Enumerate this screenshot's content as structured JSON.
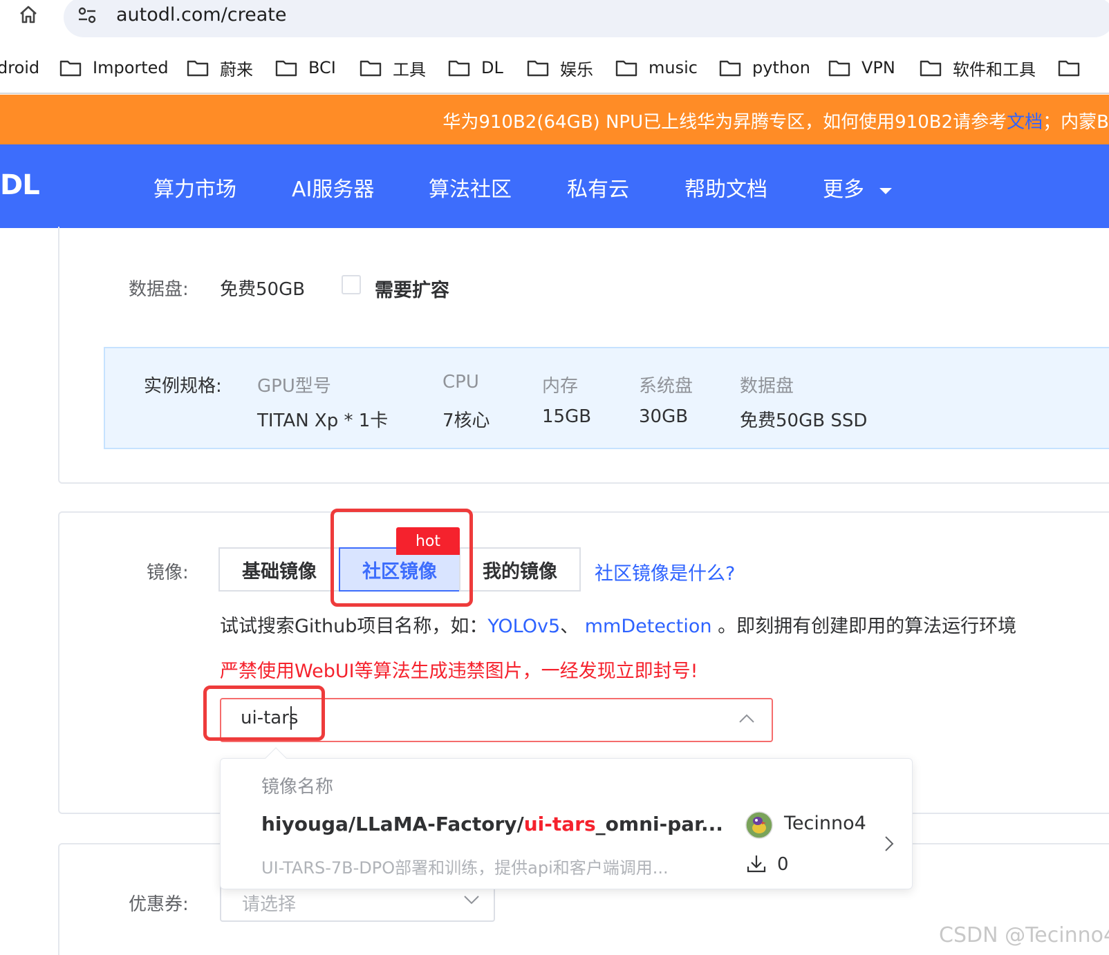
{
  "browser": {
    "url": "autodl.com/create",
    "bookmarks": [
      "droid",
      "Imported",
      "蔚来",
      "BCI",
      "工具",
      "DL",
      "娱乐",
      "music",
      "python",
      "VPN",
      "软件和工具"
    ]
  },
  "banner": {
    "text_before": "华为910B2(64GB) NPU已上线华为昇腾专区，如何使用910B2请参考",
    "link": "文档",
    "text_after": "；内蒙B"
  },
  "nav": {
    "logo": "DL",
    "items": [
      "算力市场",
      "AI服务器",
      "算法社区",
      "私有云",
      "帮助文档",
      "更多"
    ]
  },
  "datadisk": {
    "label": "数据盘:",
    "value": "免费50GB",
    "expand_label": "需要扩容"
  },
  "spec": {
    "label": "实例规格:",
    "columns": [
      {
        "header": "GPU型号",
        "value": "TITAN Xp * 1卡"
      },
      {
        "header": "CPU",
        "value": "7核心"
      },
      {
        "header": "内存",
        "value": "15GB"
      },
      {
        "header": "系统盘",
        "value": "30GB"
      },
      {
        "header": "数据盘",
        "value": "免费50GB SSD"
      }
    ]
  },
  "image": {
    "label": "镜像:",
    "tabs": [
      "基础镜像",
      "社区镜像",
      "我的镜像"
    ],
    "active_tab": "社区镜像",
    "hot_badge": "hot",
    "help_link": "社区镜像是什么?",
    "hint_before": "试试搜索Github项目名称，如：",
    "hint_link1": "YOLOv5",
    "hint_sep": "、",
    "hint_link2": "mmDetection",
    "hint_after": "。即刻拥有创建即用的算法运行环境",
    "warning": "严禁使用WebUI等算法生成违禁图片，一经发现立即封号!",
    "search_value": "ui-tars"
  },
  "dropdown": {
    "header": "镜像名称",
    "result": {
      "name_prefix": "hiyouga/LLaMA-Factory/",
      "name_highlight": "ui-tars",
      "name_suffix": "_omni-par...",
      "description": "UI-TARS-7B-DPO部署和训练，提供api和客户端调用...",
      "author": "Tecinno4",
      "downloads": "0"
    }
  },
  "coupon": {
    "label": "优惠券:",
    "placeholder": "请选择"
  },
  "watermark": "CSDN @Tecinno4",
  "colors": {
    "nav_blue": "#3d6dfc",
    "banner_orange": "#ff8c26",
    "warning_red": "#f5222d",
    "link_blue": "#2e63ff"
  }
}
